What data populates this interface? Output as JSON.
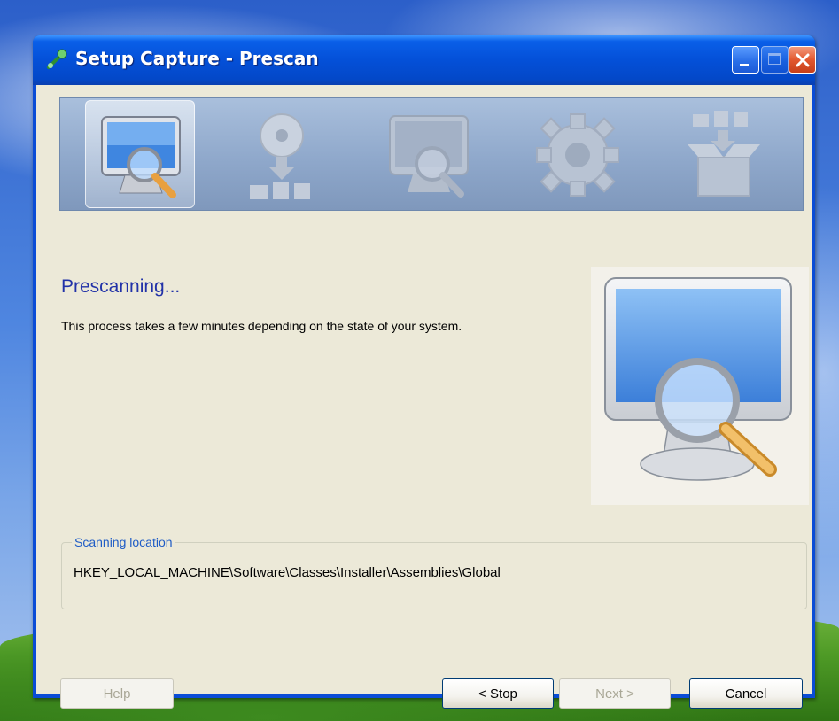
{
  "window": {
    "title": "Setup Capture - Prescan"
  },
  "steps": [
    {
      "icon": "monitor-magnifier-icon",
      "state": "active"
    },
    {
      "icon": "disc-install-icon",
      "state": "inactive"
    },
    {
      "icon": "monitor-scan-icon",
      "state": "inactive"
    },
    {
      "icon": "gear-icon",
      "state": "inactive"
    },
    {
      "icon": "package-box-icon",
      "state": "inactive"
    }
  ],
  "main": {
    "heading": "Prescanning...",
    "description": "This process takes a few minutes depending on the state of your system."
  },
  "scanning": {
    "legend": "Scanning location",
    "path": "HKEY_LOCAL_MACHINE\\Software\\Classes\\Installer\\Assemblies\\Global"
  },
  "buttons": {
    "help": "Help",
    "stop": "< Stop",
    "next": "Next >",
    "cancel": "Cancel"
  },
  "colors": {
    "titlebar": "#0450d8",
    "heading": "#2232a8",
    "legend": "#1f5cc6",
    "dialog_bg": "#ece9d8"
  }
}
